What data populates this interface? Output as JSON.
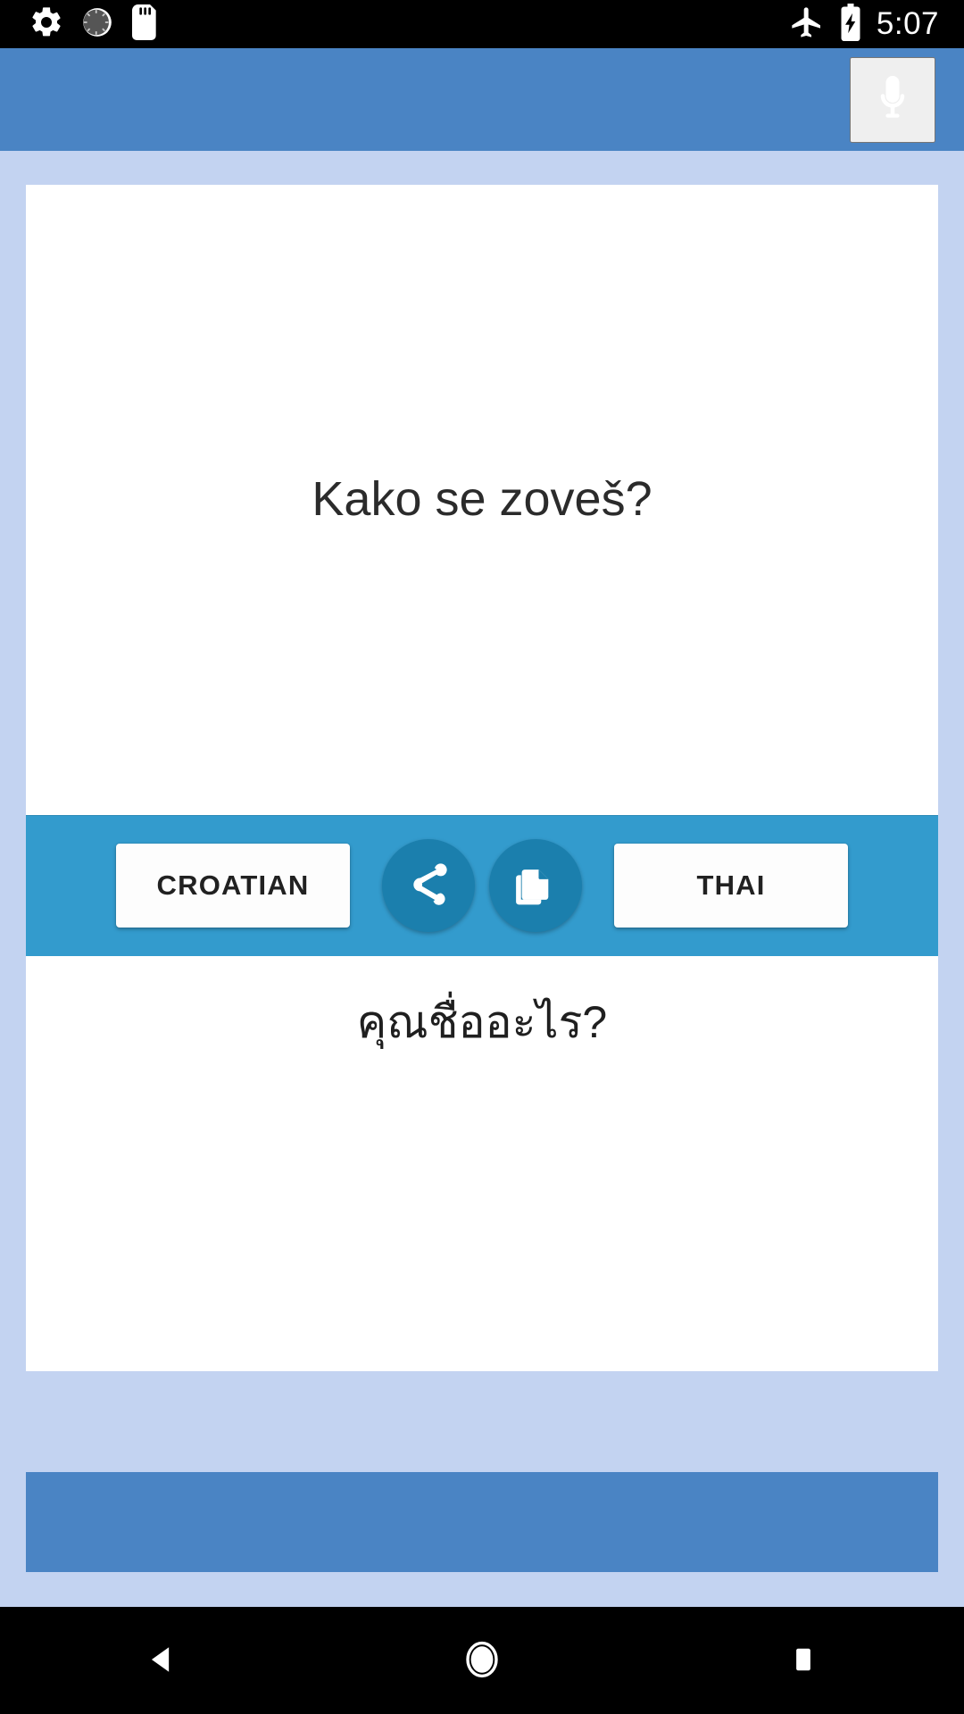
{
  "status_bar": {
    "icons_left": [
      "settings-gear-icon",
      "loading-spinner-icon",
      "sd-card-icon"
    ],
    "icons_right": [
      "airplane-mode-icon",
      "battery-charging-icon"
    ],
    "clock": "5:07"
  },
  "app_bar": {
    "title": "",
    "mic_icon": "microphone-icon",
    "background_color": "#4a84c4"
  },
  "translator": {
    "source_text": "Kako se zoveš?",
    "target_text": "คุณชื่ออะไร?",
    "source_language": "CROATIAN",
    "target_language": "THAI",
    "share_icon": "share-icon",
    "copy_icon": "copy-icon",
    "control_bar_color": "#339bcd",
    "round_button_color": "#1b7fad"
  },
  "nav_bar": {
    "back": "back-triangle-icon",
    "home": "home-circle-icon",
    "recents": "recents-square-icon"
  }
}
